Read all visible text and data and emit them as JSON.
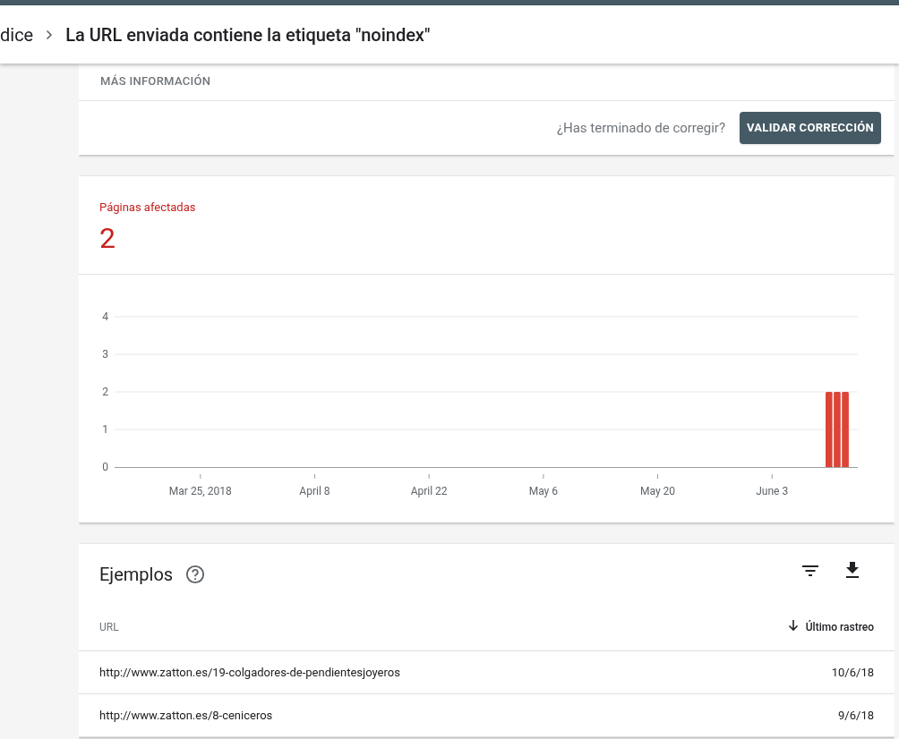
{
  "breadcrumb": {
    "parent": "dice",
    "current": "La URL enviada contiene la etiqueta \"noindex\""
  },
  "info_card": {
    "more_info": "MÁS INFORMACIÓN",
    "question": "¿Has terminado de corregir?",
    "validate_button": "VALIDAR CORRECCIÓN"
  },
  "affected": {
    "label": "Páginas afectadas",
    "count": "2",
    "chart_data": {
      "type": "bar",
      "grid": true,
      "ylim": [
        0,
        4
      ],
      "yticks": [
        0,
        1,
        2,
        3,
        4
      ],
      "categories": [
        null,
        null,
        null,
        null,
        null,
        null,
        null,
        null,
        null,
        null,
        "Mar 25, 2018",
        null,
        null,
        null,
        null,
        null,
        null,
        null,
        null,
        null,
        null,
        null,
        null,
        null,
        "April 8",
        null,
        null,
        null,
        null,
        null,
        null,
        null,
        null,
        null,
        null,
        null,
        null,
        null,
        "April 22",
        null,
        null,
        null,
        null,
        null,
        null,
        null,
        null,
        null,
        null,
        null,
        null,
        null,
        "May 6",
        null,
        null,
        null,
        null,
        null,
        null,
        null,
        null,
        null,
        null,
        null,
        null,
        null,
        "May 20",
        null,
        null,
        null,
        null,
        null,
        null,
        null,
        null,
        null,
        null,
        null,
        null,
        null,
        "June 3",
        null,
        null,
        null,
        null,
        null,
        null,
        null,
        null,
        null,
        null
      ],
      "values": [
        null,
        null,
        null,
        null,
        null,
        null,
        null,
        null,
        null,
        null,
        null,
        null,
        null,
        null,
        null,
        null,
        null,
        null,
        null,
        null,
        null,
        null,
        null,
        null,
        null,
        null,
        null,
        null,
        null,
        null,
        null,
        null,
        null,
        null,
        null,
        null,
        null,
        null,
        null,
        null,
        null,
        null,
        null,
        null,
        null,
        null,
        null,
        null,
        null,
        null,
        null,
        null,
        null,
        null,
        null,
        null,
        null,
        null,
        null,
        null,
        null,
        null,
        null,
        null,
        null,
        null,
        null,
        null,
        null,
        null,
        null,
        null,
        null,
        null,
        null,
        null,
        null,
        null,
        null,
        null,
        null,
        null,
        null,
        null,
        null,
        null,
        null,
        2,
        2,
        2,
        null
      ]
    }
  },
  "examples": {
    "title": "Ejemplos",
    "columns": [
      {
        "label": "URL",
        "sorted": false
      },
      {
        "label": "Último rastreo",
        "sorted": true
      }
    ],
    "rows": [
      {
        "url": "http://www.zatton.es/19-colgadores-de-pendientesjoyeros",
        "last_crawl": "10/6/18"
      },
      {
        "url": "http://www.zatton.es/8-ceniceros",
        "last_crawl": "9/6/18"
      }
    ]
  }
}
